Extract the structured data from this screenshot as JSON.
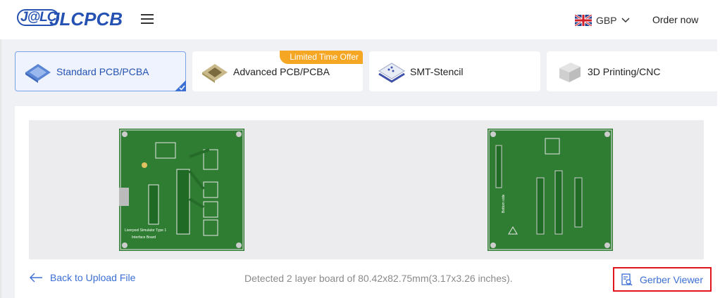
{
  "header": {
    "logo_mark": "J@LC",
    "logo_text": "JLCPCB",
    "currency": "GBP",
    "order_now": "Order now"
  },
  "tabs": [
    {
      "label": "Standard PCB/PCBA",
      "active": true
    },
    {
      "label": "Advanced PCB/PCBA",
      "badge": "Limited Time Offer"
    },
    {
      "label": "SMT-Stencil"
    },
    {
      "label": "3D Printing/CNC"
    }
  ],
  "preview": {
    "front_labels": [
      "Liverpool Simulator Type 1",
      "Interface Board"
    ],
    "back_label": "Bottom side"
  },
  "footer": {
    "back_label": "Back to Upload File",
    "detected": "Detected 2 layer board of 80.42x82.75mm(3.17x3.26 inches).",
    "gerber_label": "Gerber Viewer"
  },
  "colors": {
    "brand": "#2451b2",
    "link": "#3b6fd4",
    "pcb_green": "#2e7d32",
    "highlight": "#e0161b",
    "badge": "#f5a623"
  }
}
